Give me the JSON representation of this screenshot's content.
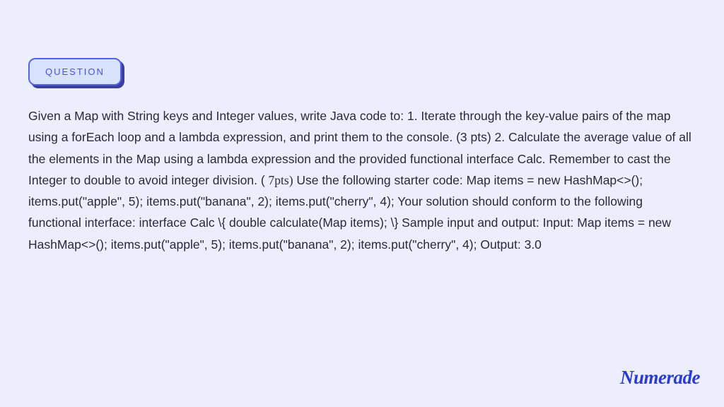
{
  "badge": {
    "label": "QUESTION"
  },
  "question": {
    "part1": "Given a Map with String keys and Integer values, write Java code to: 1. Iterate through the key-value pairs of the map using a forEach loop and a lambda expression, and print them to the console. (3 pts) 2. Calculate the average value of all the elements in the Map using a lambda expression and the provided functional interface Calc. Remember to cast the Integer to double to avoid integer division. ( ",
    "serif": "7pts)",
    "part2": " Use the following starter code: Map items = new HashMap<>(); items.put(\"apple\", 5); items.put(\"banana\", 2); items.put(\"cherry\", 4); Your solution should conform to the following functional interface: interface Calc \\{ double calculate(Map items); \\} Sample input and output: Input: Map items = new HashMap<>(); items.put(\"apple\", 5); items.put(\"banana\", 2); items.put(\"cherry\", 4); Output: 3.0"
  },
  "brand": {
    "name": "Numerade"
  }
}
